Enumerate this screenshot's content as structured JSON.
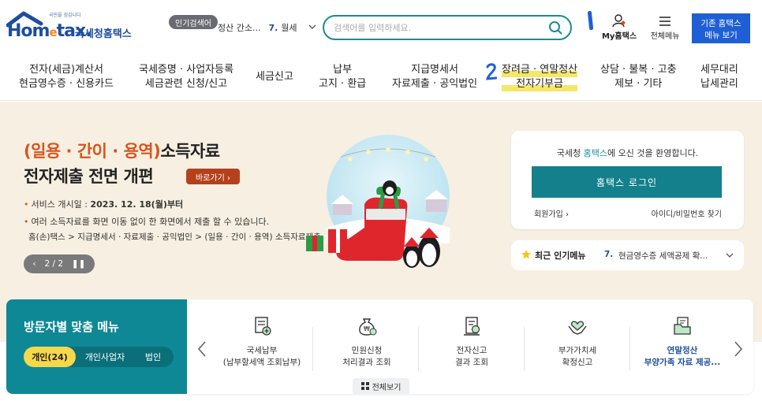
{
  "header": {
    "logo_sub": "국민을 섬깁니다",
    "logo_text": "Hometax",
    "logo_name": "국세청홈택스",
    "popular_badge": "인기검색어",
    "popular_select": {
      "prefix": "정산 간소...",
      "rank": "7.",
      "value": "월세"
    },
    "search_placeholder": "검색어를 입력하세요.",
    "marker_label": "1",
    "myhome_label": "My홈택스",
    "allmenu_label": "전체메뉴",
    "old_button": [
      "기존 홈택스",
      "메뉴 보기"
    ]
  },
  "gnb": [
    {
      "lines": [
        "전자(세금)계산서",
        "현금영수증 · 신용카드"
      ]
    },
    {
      "lines": [
        "국세증명 · 사업자등록",
        "세금관련 신청/신고"
      ]
    },
    {
      "lines": [
        "세금신고"
      ]
    },
    {
      "lines": [
        "납부",
        "고지 · 환급"
      ]
    },
    {
      "lines": [
        "지급명세서",
        "자료제출 · 공익법인"
      ]
    },
    {
      "lines": [
        "장려금 · 연말정산",
        "전자기부금"
      ]
    },
    {
      "lines": [
        "상담 · 불복 · 고충",
        "제보 · 기타"
      ]
    },
    {
      "lines": [
        "세무대리",
        "납세관리"
      ]
    }
  ],
  "gnb_marker": "2",
  "hero": {
    "title1_highlight": "(일용 · 간이 · 용역)",
    "title1_rest": "소득자료",
    "title2": "전자제출 전면 개편",
    "go_button": "바로가기  ›",
    "line1_label": "서비스 개시일 : ",
    "line1_value": "2023. 12. 18(월)부터",
    "line2": "여러 소득자료를 화면 이동 없이 한 화면에서 제출 할 수 있습니다.",
    "line3": "홈(손)택스 > 지급명세서 · 자료제출 · 공익법인 > (일용 · 간이 · 용역) 소득자료제출",
    "pager": "2 / 2"
  },
  "login": {
    "welcome_prefix": "국세청 ",
    "welcome_accent": "홈택스",
    "welcome_suffix": "에 오신 것을 환영합니다.",
    "login_button": "홈택스 로그인",
    "join": "회원가입",
    "find": "아이디/비밀번호 찾기"
  },
  "popular_menu": {
    "title": "최근 인기메뉴",
    "rank": "7.",
    "text": "현금영수증 세액공제 확..."
  },
  "visitor": {
    "title": "방문자별 맞춤 메뉴",
    "options": [
      "개인(24)",
      "개인사업자",
      "법인"
    ]
  },
  "quick_menu": [
    {
      "l1": "국세납부",
      "l2": "(납부할세액 조회납부)",
      "icon": "tax-payment-icon",
      "highlight": false
    },
    {
      "l1": "민원신청",
      "l2": "처리결과 조회",
      "icon": "money-bag-icon",
      "highlight": false
    },
    {
      "l1": "전자신고",
      "l2": "결과 조회",
      "icon": "document-check-icon",
      "highlight": false
    },
    {
      "l1": "부가가치세",
      "l2": "확정신고",
      "icon": "hands-heart-icon",
      "highlight": true
    },
    {
      "l1": "연말정산",
      "l2": "부양가족 자료 제공...",
      "icon": "folder-doc-icon",
      "highlight": true
    }
  ],
  "all_view": "전체보기",
  "colors": {
    "brand": "#1d4e9e",
    "teal": "#14808b",
    "accent_orange": "#d9531e",
    "blue_button": "#1f5fd6",
    "highlight_yellow": "#f6e66a",
    "hero_bg": "#f7f0e2"
  }
}
